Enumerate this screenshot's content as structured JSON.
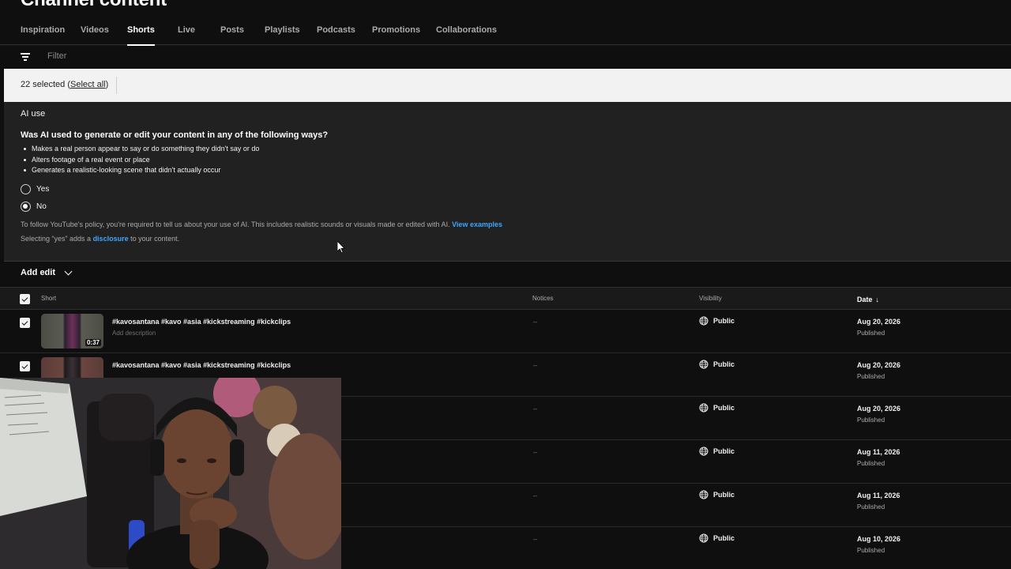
{
  "page": {
    "title": "Channel content"
  },
  "tabs": [
    {
      "label": "Inspiration",
      "active": false
    },
    {
      "label": "Videos",
      "active": false
    },
    {
      "label": "Shorts",
      "active": true
    },
    {
      "label": "Live",
      "active": false
    },
    {
      "label": "Posts",
      "active": false
    },
    {
      "label": "Playlists",
      "active": false
    },
    {
      "label": "Podcasts",
      "active": false
    },
    {
      "label": "Promotions",
      "active": false
    },
    {
      "label": "Collaborations",
      "active": false
    }
  ],
  "filter": {
    "placeholder": "Filter",
    "icon": "filter-icon"
  },
  "selection": {
    "count_text": "22 selected (",
    "select_all": "Select all",
    "close_paren": ")"
  },
  "ai_use": {
    "title": "AI use",
    "question": "Was AI used to generate or edit your content in any of the following ways?",
    "bullets": [
      "Makes a real person appear to say or do something they didn't say or do",
      "Alters footage of a real event or place",
      "Generates a realistic-looking scene that didn't actually occur"
    ],
    "options": [
      {
        "label": "Yes",
        "checked": false
      },
      {
        "label": "No",
        "checked": true
      }
    ],
    "policy_text": "To follow YouTube's policy, you're required to tell us about your use of AI. This includes realistic sounds or visuals made or edited with AI.",
    "policy_link": "View examples",
    "disclosure_prefix": "Selecting “yes” adds a",
    "disclosure_link": "disclosure",
    "disclosure_suffix": "to your content."
  },
  "add_edit": {
    "label": "Add edit"
  },
  "table": {
    "headers": {
      "short": "Short",
      "notices": "Notices",
      "visibility": "Visibility",
      "date": "Date"
    },
    "rows": [
      {
        "title": "#kavosantana #kavo #asia #kickstreaming #kickclips",
        "description": "Add description",
        "duration": "0:37",
        "notice": "–",
        "visibility": "Public",
        "date": "Aug 20, 2026",
        "status": "Published"
      },
      {
        "title": "#kavosantana #kavo #asia #kickstreaming #kickclips",
        "description": "",
        "duration": "",
        "notice": "–",
        "visibility": "Public",
        "date": "Aug 20, 2026",
        "status": "Published"
      },
      {
        "title": "",
        "description": "",
        "duration": "",
        "notice": "–",
        "visibility": "Public",
        "date": "Aug 20, 2026",
        "status": "Published"
      },
      {
        "title": "",
        "description": "",
        "duration": "",
        "notice": "–",
        "visibility": "Public",
        "date": "Aug 11, 2026",
        "status": "Published"
      },
      {
        "title": "",
        "description": "",
        "duration": "",
        "notice": "–",
        "visibility": "Public",
        "date": "Aug 11, 2026",
        "status": "Published"
      },
      {
        "title": "",
        "description": "",
        "duration": "",
        "notice": "–",
        "visibility": "Public",
        "date": "Aug 10, 2026",
        "status": "Published"
      }
    ]
  },
  "colors": {
    "accent_link": "#3ea6ff",
    "background": "#0f0f0f",
    "panel": "#212121",
    "selection_bar": "#f2f2f2"
  }
}
